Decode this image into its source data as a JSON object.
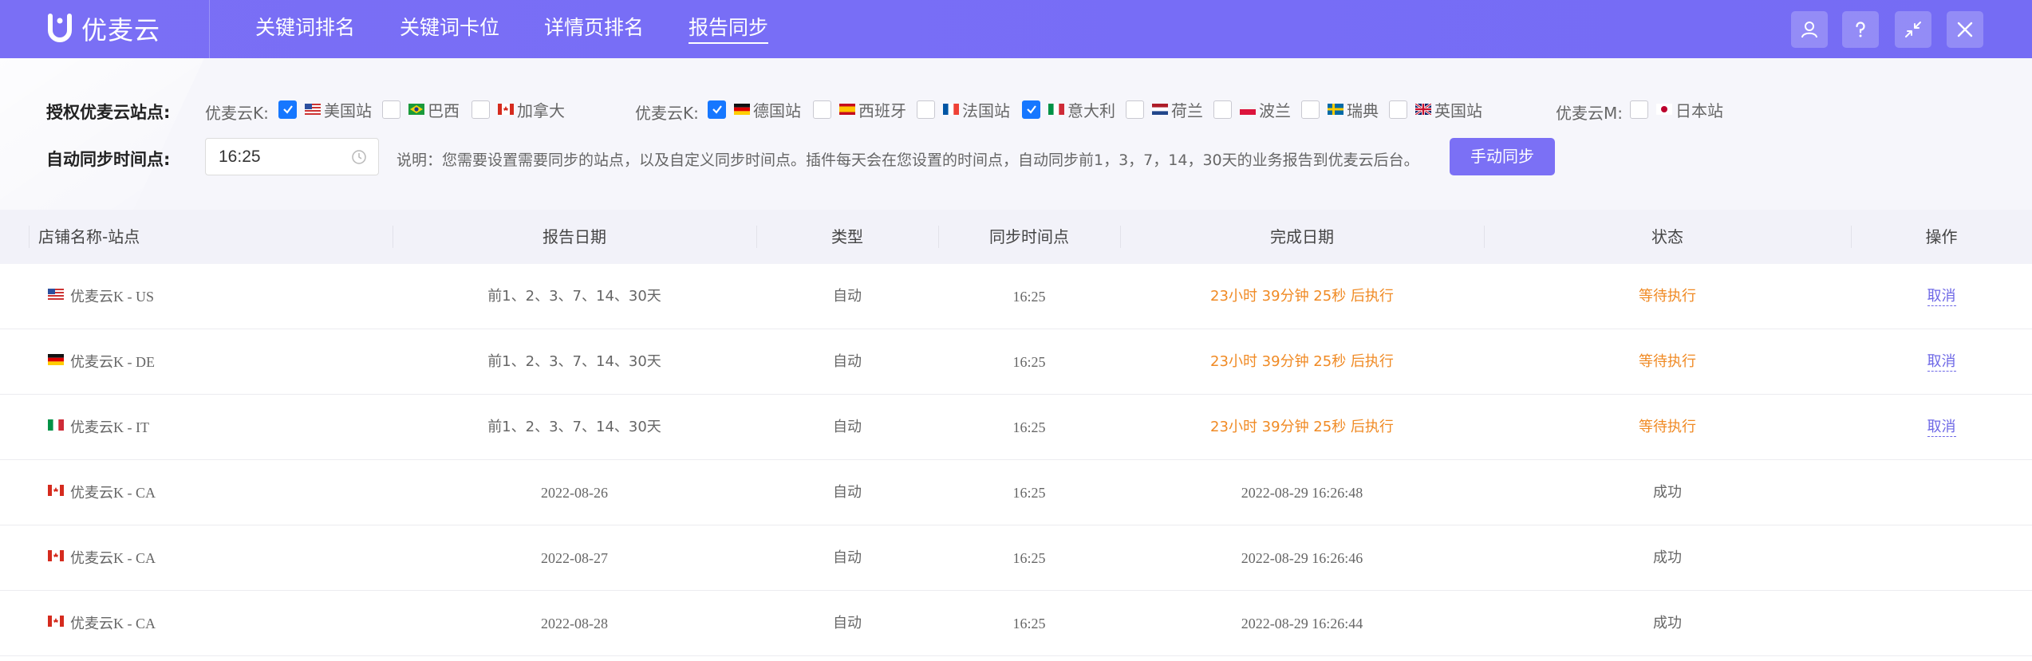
{
  "header": {
    "logo_text": "优麦云",
    "nav": [
      "关键词排名",
      "关键词卡位",
      "详情页排名",
      "报告同步"
    ],
    "active_tab": 3,
    "buttons": [
      "user-icon",
      "help-icon",
      "shrink-icon",
      "close-icon"
    ]
  },
  "config": {
    "sites_label": "授权优麦云站点:",
    "groups": [
      {
        "label": "优麦云K:",
        "sites": [
          {
            "name": "美国站",
            "flag": "us",
            "checked": true
          },
          {
            "name": "巴西",
            "flag": "br",
            "checked": false
          },
          {
            "name": "加拿大",
            "flag": "ca",
            "checked": false
          }
        ]
      },
      {
        "label": "优麦云K:",
        "sites": [
          {
            "name": "德国站",
            "flag": "de",
            "checked": true
          },
          {
            "name": "西班牙",
            "flag": "es",
            "checked": false
          },
          {
            "name": "法国站",
            "flag": "fr",
            "checked": false
          },
          {
            "name": "意大利",
            "flag": "it",
            "checked": true
          },
          {
            "name": "荷兰",
            "flag": "nl",
            "checked": false
          },
          {
            "name": "波兰",
            "flag": "pl",
            "checked": false
          },
          {
            "name": "瑞典",
            "flag": "se",
            "checked": false
          },
          {
            "name": "英国站",
            "flag": "gb",
            "checked": false
          }
        ]
      },
      {
        "label": "优麦云M:",
        "sites": [
          {
            "name": "日本站",
            "flag": "jp",
            "checked": false
          }
        ]
      }
    ],
    "time_label": "自动同步时间点:",
    "time_value": "16:25",
    "note": "说明：您需要设置需要同步的站点，以及自定义同步时间点。插件每天会在您设置的时间点，自动同步前1，3，7，14，30天的业务报告到优麦云后台。",
    "sync_button": "手动同步"
  },
  "table": {
    "columns": [
      "店铺名称-站点",
      "报告日期",
      "类型",
      "同步时间点",
      "完成日期",
      "状态",
      "操作"
    ],
    "rows": [
      {
        "flag": "us",
        "store": "优麦云K - US",
        "report_date": "前1、2、3、7、14、30天",
        "type": "自动",
        "sync_time": "16:25",
        "done": "23小时 39分钟 25秒 后执行",
        "status": "等待执行",
        "action": "取消",
        "pending": true
      },
      {
        "flag": "de",
        "store": "优麦云K - DE",
        "report_date": "前1、2、3、7、14、30天",
        "type": "自动",
        "sync_time": "16:25",
        "done": "23小时 39分钟 25秒 后执行",
        "status": "等待执行",
        "action": "取消",
        "pending": true
      },
      {
        "flag": "it",
        "store": "优麦云K - IT",
        "report_date": "前1、2、3、7、14、30天",
        "type": "自动",
        "sync_time": "16:25",
        "done": "23小时 39分钟 25秒 后执行",
        "status": "等待执行",
        "action": "取消",
        "pending": true
      },
      {
        "flag": "ca",
        "store": "优麦云K - CA",
        "report_date": "2022-08-26",
        "type": "自动",
        "sync_time": "16:25",
        "done": "2022-08-29 16:26:48",
        "status": "成功",
        "action": "",
        "pending": false
      },
      {
        "flag": "ca",
        "store": "优麦云K - CA",
        "report_date": "2022-08-27",
        "type": "自动",
        "sync_time": "16:25",
        "done": "2022-08-29 16:26:46",
        "status": "成功",
        "action": "",
        "pending": false
      },
      {
        "flag": "ca",
        "store": "优麦云K - CA",
        "report_date": "2022-08-28",
        "type": "自动",
        "sync_time": "16:25",
        "done": "2022-08-29 16:26:44",
        "status": "成功",
        "action": "",
        "pending": false
      }
    ]
  },
  "colors": {
    "header_bg": "#776df6",
    "accent": "#7b70f5",
    "checkbox": "#1677ff",
    "pending": "#f08a24",
    "link": "#6e68e6"
  }
}
